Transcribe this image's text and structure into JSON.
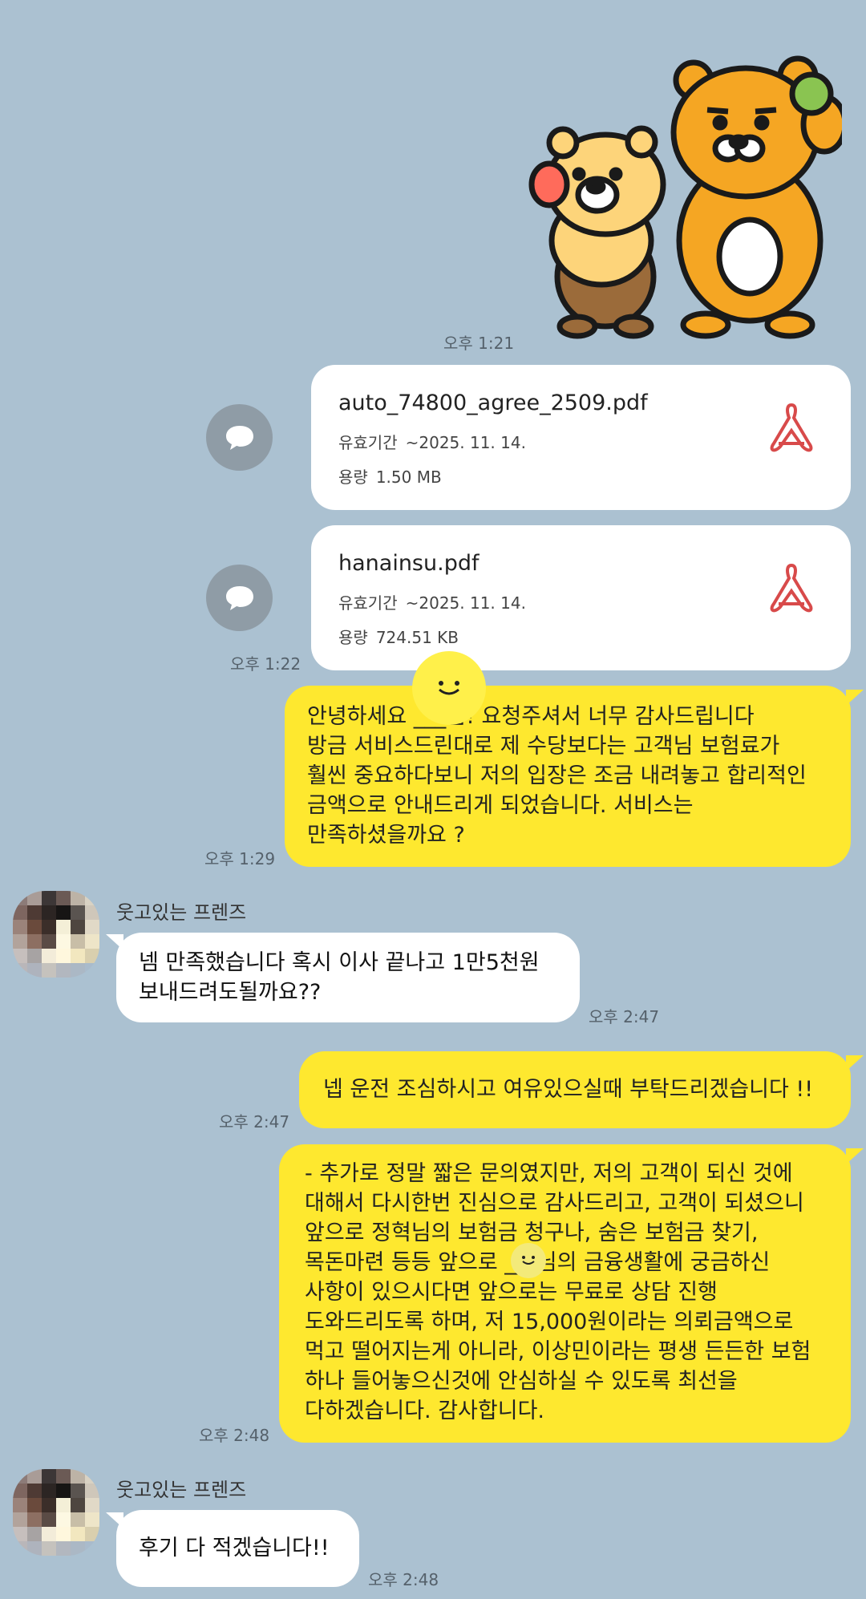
{
  "sticker": {
    "icon": "lion-friends-sticker-icon"
  },
  "sticker_time": "오후 1:21",
  "files": [
    {
      "name": "auto_74800_agree_2509.pdf",
      "expiry_label": "유효기간",
      "expiry": "~2025. 11. 14.",
      "size_label": "용량",
      "size": "1.50 MB",
      "icon": "pdf-icon"
    },
    {
      "name": "hanainsu.pdf",
      "expiry_label": "유효기간",
      "expiry": "~2025. 11. 14.",
      "size_label": "용량",
      "size": "724.51 KB",
      "icon": "pdf-icon"
    }
  ],
  "files_time": "오후 1:22",
  "messages": [
    {
      "from": "me",
      "lines": [
        "안녕하세요 ___님! 요청주셔서 너무 감사드립니다",
        "방금 서비스드린대로 제 수당보다는 고객님 보험료가",
        "훨씬 중요하다보니 저의 입장은 조금 내려놓고 합리적인",
        "금액으로 안내드리게 되었습니다. 서비스는",
        "만족하셨을까요 ?"
      ],
      "time": "오후 1:29"
    },
    {
      "from": "friend",
      "sender": "웃고있는 프렌즈",
      "lines": [
        "넴 만족했습니다 혹시 이사 끝나고 1만5천원",
        "보내드려도될까요??"
      ],
      "time": "오후 2:47"
    },
    {
      "from": "me",
      "lines": [
        "넵 운전 조심하시고 여유있으실때 부탁드리겠습니다 !!"
      ],
      "time": "오후 2:47"
    },
    {
      "from": "me",
      "lines": [
        "- 추가로 정말 짧은 문의였지만, 저의 고객이 되신 것에",
        "대해서 다시한번 진심으로 감사드리고, 고객이 되셨으니",
        "앞으로 정혁님의 보험금 청구나, 숨은 보험금 찾기,",
        "목돈마련 등등 앞으로 ___님의 금융생활에 궁금하신",
        "사항이 있으시다면 앞으로는 무료로 상담 진행",
        "도와드리도록 하며, 저 15,000원이라는 의뢰금액으로",
        "먹고 떨어지는게 아니라, 이상민이라는 평생 든든한 보험",
        "하나 들어놓으신것에 안심하실 수 있도록 최선을",
        "다하겠습니다. 감사합니다."
      ],
      "time": "오후 2:48"
    },
    {
      "from": "friend",
      "sender": "웃고있는 프렌즈",
      "lines": [
        "후기 다 적겠습니다!!"
      ],
      "time": "오후 2:48"
    }
  ],
  "colors": {
    "background": "#abc1d1",
    "my_bubble": "#fee82f",
    "friend_bubble": "#ffffff",
    "pdf_red": "#d84a4a"
  },
  "icons": {
    "share": "speech-bubble-share-icon",
    "redaction": "smiley-redaction-icon",
    "avatar": "pixelated-avatar-icon"
  }
}
